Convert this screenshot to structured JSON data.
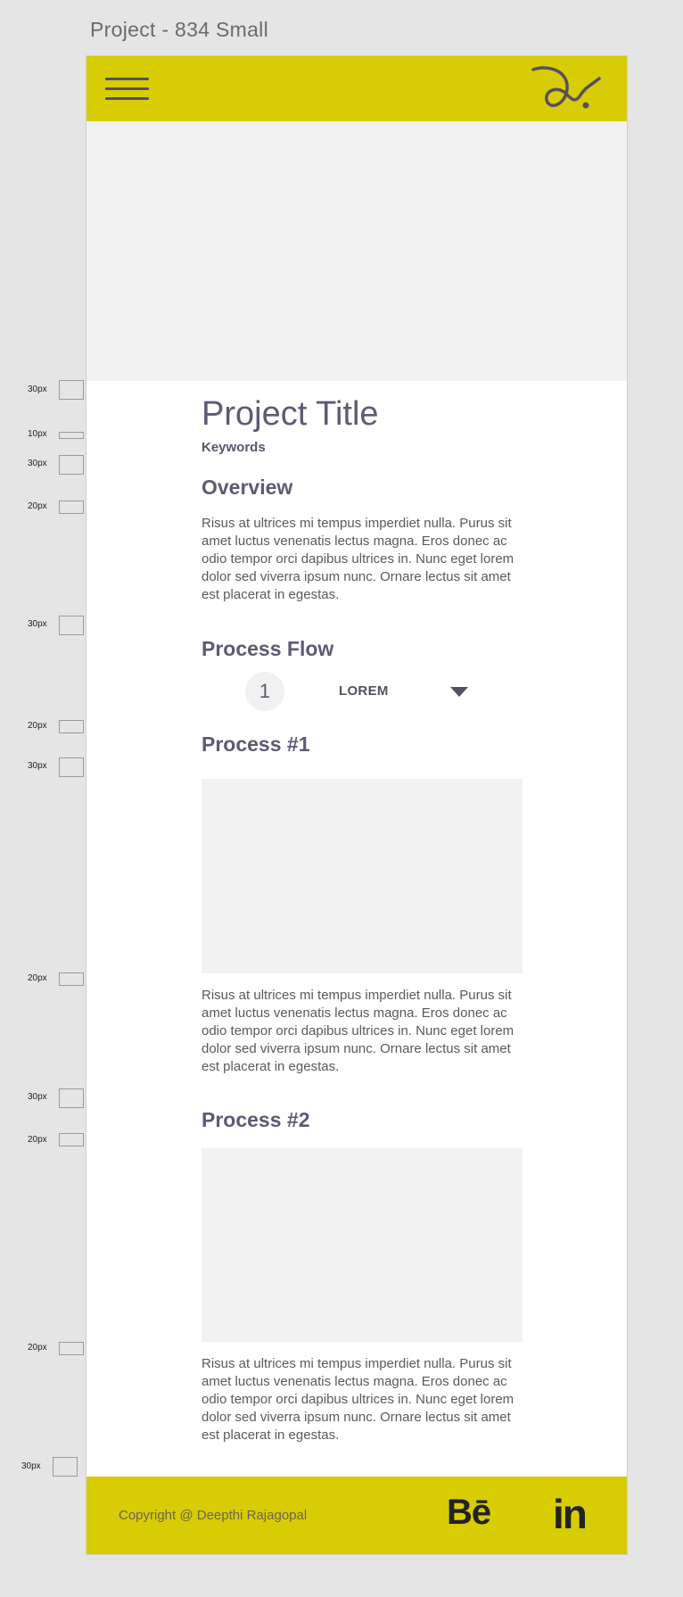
{
  "frame_title": "Project - 834 Small",
  "page": {
    "project_title": "Project Title",
    "keywords": "Keywords",
    "overview_heading": "Overview",
    "overview_text": "Risus at ultrices mi tempus imperdiet nulla. Purus sit amet luctus venenatis lectus magna. Eros donec ac odio tempor orci dapibus ultrices in. Nunc eget lorem dolor sed viverra ipsum nunc. Ornare lectus sit amet est placerat in egestas.",
    "process_flow_heading": "Process Flow",
    "flow_step_number": "1",
    "flow_step_label": "LOREM",
    "process1_heading": "Process #1",
    "process1_text": "Risus at ultrices mi tempus imperdiet nulla. Purus sit amet luctus venenatis lectus magna. Eros donec ac odio tempor orci dapibus ultrices in. Nunc eget lorem dolor sed viverra ipsum nunc. Ornare lectus sit amet est placerat in egestas.",
    "process2_heading": "Process #2",
    "process2_text": "Risus at ultrices mi tempus imperdiet nulla. Purus sit amet luctus venenatis lectus magna. Eros donec ac odio tempor orci dapibus ultrices in. Nunc eget lorem dolor sed viverra ipsum nunc. Ornare lectus sit amet est placerat in egestas."
  },
  "footer": {
    "copyright": "Copyright @ Deepthi Rajagopal",
    "behance": "Bē",
    "linkedin": "in"
  },
  "measurements": [
    "30px",
    "10px",
    "30px",
    "20px",
    "30px",
    "20px",
    "30px",
    "20px",
    "30px",
    "20px",
    "20px",
    "30px"
  ],
  "colors": {
    "brand_yellow": "#d8cc05",
    "heading": "#5e5a73",
    "placeholder_gray": "#f2f2f2"
  },
  "icons": [
    "menu-icon",
    "logo-signature",
    "dropdown-caret-icon",
    "behance-icon",
    "linkedin-icon"
  ]
}
